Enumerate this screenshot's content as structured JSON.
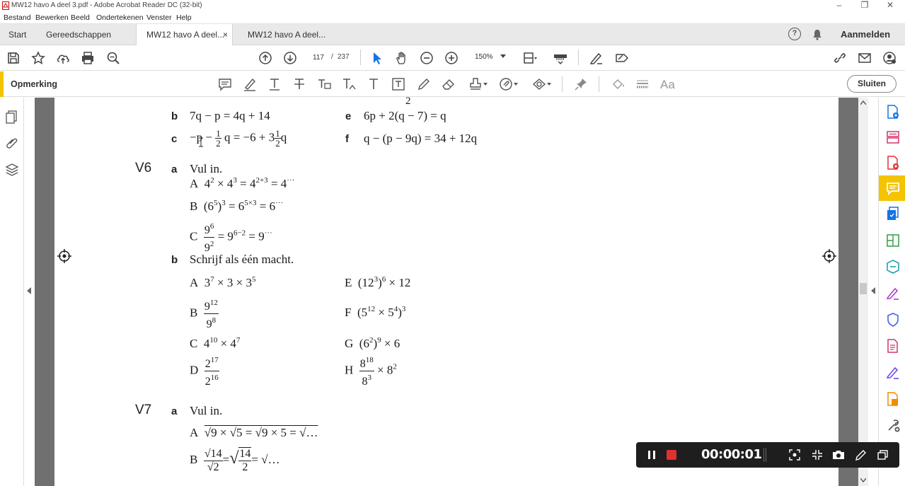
{
  "window": {
    "title": "MW12 havo A deel 3.pdf - Adobe Acrobat Reader DC (32-bit)",
    "minimize": "–",
    "maximize": "❐",
    "close": "✕"
  },
  "menu": [
    "Bestand",
    "Bewerken",
    "Beeld",
    "Ondertekenen",
    "Venster",
    "Help"
  ],
  "tabs": {
    "start": "Start",
    "tools": "Gereedschappen",
    "doc1": "MW12 havo A deel...",
    "doc1_close": "×",
    "doc2": "MW12 havo A deel..."
  },
  "header_right": {
    "help": "?",
    "signin": "Aanmelden"
  },
  "toolbar": {
    "page_current": "117",
    "page_separator": "/",
    "page_total": "237",
    "zoom": "150%"
  },
  "comment_bar": {
    "label": "Opmerking",
    "close": "Sluiten",
    "text_size_icon": "Aa"
  },
  "document": {
    "top_fragment": "2",
    "line_b_letter": "b",
    "line_b": "7q − p = 4q + 14",
    "line_e_letter": "e",
    "line_e": "6p + 2(q − 7) = q",
    "line_c_letter": "c",
    "line_c_pre": "−p −",
    "line_c_mid": "q = −6 + 3",
    "line_c_post": "q",
    "half_n": "1",
    "half_d": "2",
    "line_f_letter": "f",
    "line_f": "q − (p − 9q) = 34 + 12q",
    "v6": {
      "label": "V6",
      "a_letter": "a",
      "a_text": "Vul in.",
      "A": {
        "label": "A",
        "pre": "4",
        "e1": "2",
        "m1": " × 4",
        "e2": "3",
        "m2": " = 4",
        "e3": "2+3",
        "m3": " = 4",
        "e4": "···"
      },
      "B": {
        "label": "B",
        "pre": "(6",
        "e1": "5",
        "m1": ")",
        "e2": "3",
        "m2": " = 6",
        "e3": "5×3",
        "m3": " = 6",
        "e4": "···"
      },
      "C": {
        "label": "C",
        "num_base": "9",
        "num_exp": "6",
        "den_base": "9",
        "den_exp": "2",
        "m1": " = 9",
        "e1": "6−2",
        "m2": " = 9",
        "e2": "···"
      },
      "b_letter": "b",
      "b_text": "Schrijf als één macht.",
      "items": {
        "A": {
          "label": "A",
          "p1": "3",
          "e1": "7",
          "p2": " × 3 × 3",
          "e2": "5"
        },
        "E": {
          "label": "E",
          "p1": "(12",
          "e1": "3",
          "p2": ")",
          "e2": "6",
          "p3": " × 12"
        },
        "B": {
          "label": "B",
          "nb": "9",
          "ne": "12",
          "db": "9",
          "de": "8"
        },
        "F": {
          "label": "F",
          "p1": "(5",
          "e1": "12",
          "p2": " × 5",
          "e2": "4",
          "p3": ")",
          "e3": "3"
        },
        "C": {
          "label": "C",
          "p1": "4",
          "e1": "10",
          "p2": " × 4",
          "e2": "7"
        },
        "G": {
          "label": "G",
          "p1": "(6",
          "e1": "2",
          "p2": ")",
          "e2": "9",
          "p3": " × 6"
        },
        "D": {
          "label": "D",
          "nb": "2",
          "ne": "17",
          "db": "2",
          "de": "16"
        },
        "H": {
          "label": "H",
          "nb": "8",
          "ne": "18",
          "db": "8",
          "de": "3",
          "p1": " × 8",
          "e1": "2"
        }
      }
    },
    "v7": {
      "label": "V7",
      "a_letter": "a",
      "a_text": "Vul in.",
      "A": {
        "label": "A",
        "text": "√9 × √5 = √9 × 5 = √…"
      },
      "B": {
        "label": "B",
        "n1": "√14",
        "d1": "√2",
        "eq1": "=",
        "sq": "√",
        "n2": "14",
        "d2": "2",
        "eq2": "= √…"
      }
    }
  },
  "recorder": {
    "time": "00:00:01"
  }
}
